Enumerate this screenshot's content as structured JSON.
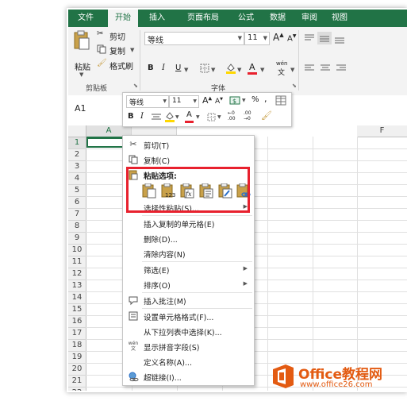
{
  "tabs": [
    "文件",
    "开始",
    "插入",
    "页面布局",
    "公式",
    "数据",
    "审阅",
    "视图"
  ],
  "active_tab": "开始",
  "clipboard": {
    "paste": "粘贴",
    "cut": "剪切",
    "copy": "复制",
    "format_painter": "格式刷",
    "group_label": "剪贴板"
  },
  "font": {
    "name": "等线",
    "size": "11",
    "bold": "B",
    "italic": "I",
    "underline": "U",
    "grow": "A",
    "shrink": "A",
    "wen": "wén",
    "wen_char": "文",
    "group_label": "字体"
  },
  "name_box": "A1",
  "columns": [
    "A",
    "F"
  ],
  "rows": [
    "1",
    "2",
    "3",
    "4",
    "5",
    "6",
    "7",
    "8",
    "9",
    "10",
    "11",
    "12",
    "13",
    "14",
    "15",
    "16",
    "17",
    "18",
    "19",
    "20",
    "21",
    "22"
  ],
  "mini_toolbar": {
    "font": "等线",
    "size": "11",
    "bold": "B",
    "italic": "I",
    "percent": "%",
    "comma": ",",
    "dec_inc": "+.0\n.00",
    "dec_dec": ".00\n+.0"
  },
  "context_menu": {
    "cut": "剪切(T)",
    "copy": "复制(C)",
    "paste_options": "粘贴选项:",
    "paste_icon_labels": [
      "123",
      "fx"
    ],
    "paste_special": "选择性粘贴(S)...",
    "insert_copied": "插入复制的单元格(E)",
    "delete": "删除(D)...",
    "clear": "清除内容(N)",
    "filter": "筛选(E)",
    "sort": "排序(O)",
    "insert_comment": "插入批注(M)",
    "format_cells": "设置单元格格式(F)...",
    "dropdown_pick": "从下拉列表中选择(K)...",
    "phonetic": "显示拼音字段(S)",
    "define_name": "定义名称(A)...",
    "hyperlink": "超链接(I)...",
    "phonetic_icon": "wén"
  },
  "watermark": {
    "title": "Office教程网",
    "url": "www.office26.com"
  },
  "colors": {
    "excel_green": "#217346",
    "highlight_red": "#e8212e",
    "watermark_orange": "#e35b12"
  }
}
